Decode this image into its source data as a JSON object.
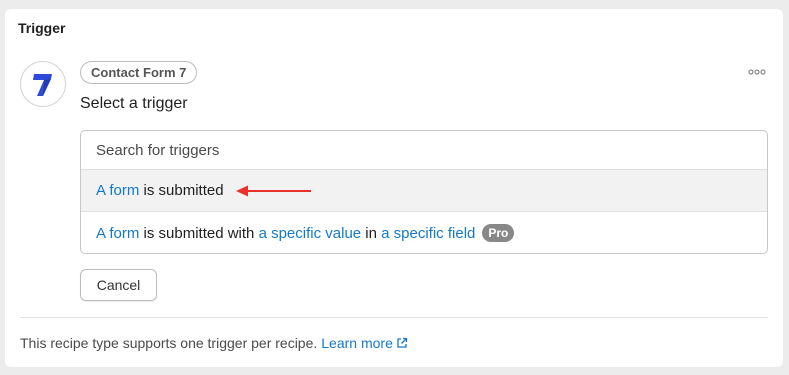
{
  "card": {
    "title": "Trigger"
  },
  "integration": {
    "name": "Contact Form 7",
    "logo_icon": "contact-form-7-icon"
  },
  "more_menu": {
    "icon": "ellipsis-icon"
  },
  "select_label": "Select a trigger",
  "search": {
    "placeholder": "Search for triggers",
    "value": ""
  },
  "options": [
    {
      "parts": [
        "A form",
        " is submitted"
      ]
    },
    {
      "parts": [
        "A form",
        " is submitted with ",
        "a specific value",
        " in ",
        "a specific field"
      ],
      "badge": "Pro"
    }
  ],
  "cancel_label": "Cancel",
  "footer": {
    "text": "This recipe type supports one trigger per recipe.",
    "link": "Learn more"
  },
  "colors": {
    "link": "#1479c9",
    "arrow": "#e8322b",
    "badge": "#888888",
    "logo": "#2f4ad8"
  }
}
